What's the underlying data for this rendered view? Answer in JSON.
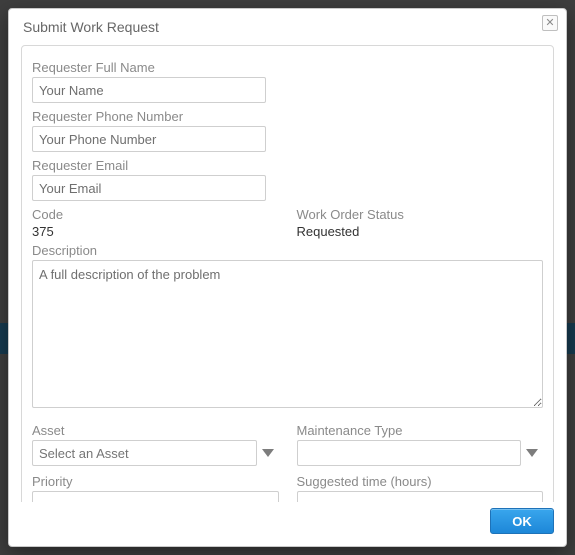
{
  "modal": {
    "title": "Submit Work Request",
    "close_glyph": "✕",
    "ok_label": "OK"
  },
  "form": {
    "requester_name": {
      "label": "Requester Full Name",
      "placeholder": "Your Name",
      "value": ""
    },
    "requester_phone": {
      "label": "Requester Phone Number",
      "placeholder": "Your Phone Number",
      "value": ""
    },
    "requester_email": {
      "label": "Requester Email",
      "placeholder": "Your Email",
      "value": ""
    },
    "code": {
      "label": "Code",
      "value": "375"
    },
    "status": {
      "label": "Work Order Status",
      "value": "Requested"
    },
    "description": {
      "label": "Description",
      "placeholder": "A full description of the problem",
      "value": ""
    },
    "asset": {
      "label": "Asset",
      "placeholder": "Select an Asset",
      "value": ""
    },
    "maintenance_type": {
      "label": "Maintenance Type",
      "value": ""
    },
    "priority": {
      "label": "Priority",
      "value": ""
    },
    "suggested_time": {
      "label": "Suggested time (hours)",
      "value": ""
    }
  }
}
